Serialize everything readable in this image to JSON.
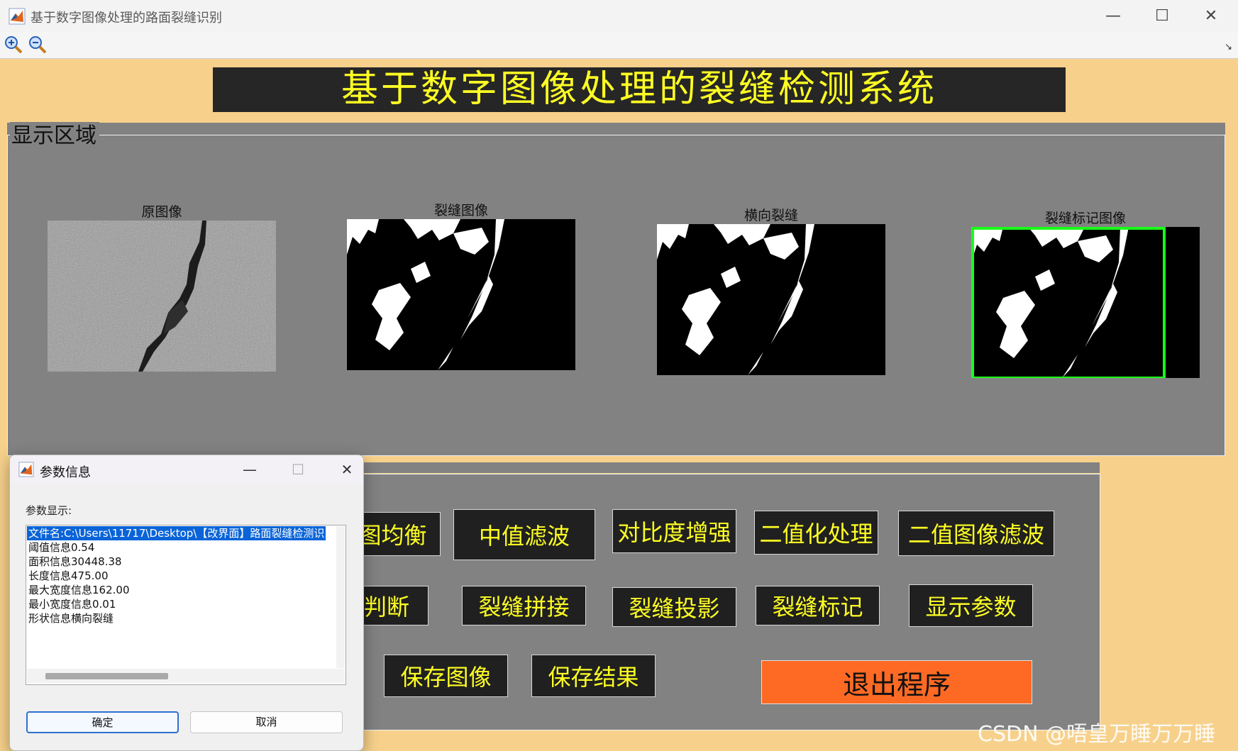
{
  "window": {
    "title": "基于数字图像处理的路面裂缝识别",
    "minimize": "—",
    "maximize": "☐",
    "close": "✕"
  },
  "toolbar": {
    "zoom_in_icon": "zoom-in-icon",
    "zoom_out_icon": "zoom-out-icon"
  },
  "header": {
    "banner": "基于数字图像处理的裂缝检测系统"
  },
  "display_panel": {
    "legend": "显示区域",
    "images": [
      {
        "caption": "原图像"
      },
      {
        "caption": "裂缝图像"
      },
      {
        "caption": "横向裂缝"
      },
      {
        "caption": "裂缝标记图像"
      }
    ]
  },
  "controls": {
    "row1": [
      "图均衡",
      "中值滤波",
      "对比度增强",
      "二值化处理",
      "二值图像滤波"
    ],
    "row2": [
      "判断",
      "裂缝拼接",
      "裂缝投影",
      "裂缝标记",
      "显示参数"
    ],
    "row3": [
      "保存图像",
      "保存结果"
    ],
    "exit": "退出程序",
    "colors": {
      "button_bg": "#202020",
      "button_text": "#ffff23",
      "exit_bg": "#fe6a24"
    }
  },
  "dialog": {
    "title": "参数信息",
    "minimize": "—",
    "maximize": "☐",
    "close": "✕",
    "label": "参数显示:",
    "list": [
      "文件名:C:\\Users\\11717\\Desktop\\【改界面】路面裂缝检测识",
      "阈值信息0.54",
      "面积信息30448.38",
      "长度信息475.00",
      "最大宽度信息162.00",
      "最小宽度信息0.01",
      "形状信息横向裂缝"
    ],
    "ok": "确定",
    "cancel": "取消"
  },
  "watermark": "CSDN @唔皇万睡万万睡"
}
